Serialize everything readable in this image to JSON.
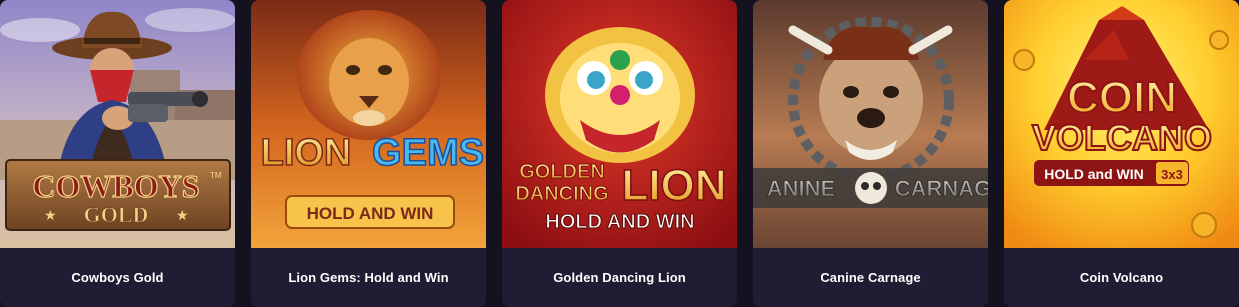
{
  "games": [
    {
      "title": "Cowboys Gold",
      "art_text": [
        "COWBOYS",
        "GOLD"
      ],
      "art_mark": "TM"
    },
    {
      "title": "Lion Gems: Hold and Win",
      "art_text": [
        "LION",
        "GEMS",
        "HOLD AND WIN"
      ]
    },
    {
      "title": "Golden Dancing Lion",
      "art_text": [
        "GOLDEN",
        "DANCING",
        "LION",
        "HOLD AND WIN"
      ]
    },
    {
      "title": "Canine Carnage",
      "art_text": [
        "ANINE",
        "CARNAG"
      ]
    },
    {
      "title": "Coin Volcano",
      "art_text": [
        "COIN",
        "VOLCANO",
        "HOLD and WIN",
        "3x3"
      ]
    }
  ],
  "colors": {
    "page_bg": "#14121f",
    "card_bg": "#1f1c33",
    "title_text": "#ffffff"
  }
}
